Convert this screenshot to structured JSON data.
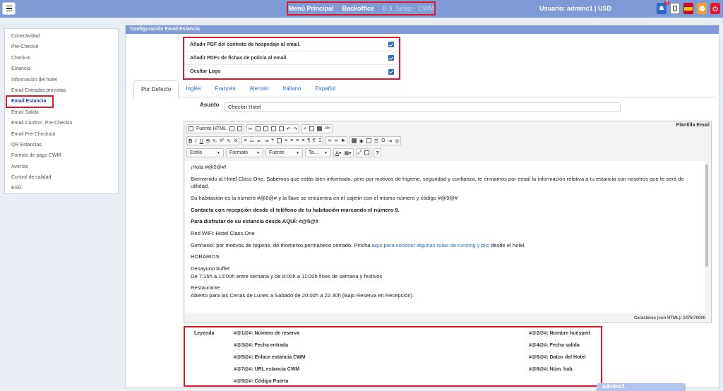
{
  "topbar": {
    "nav": [
      "Menú Principal",
      "Backoffice",
      "B.9. Setup - CWM"
    ],
    "user": "Usuario: adminc1 | USD",
    "badge_count": "8"
  },
  "sidebar": {
    "items": [
      {
        "label": "Conectividad"
      },
      {
        "label": "Pre-Checkin"
      },
      {
        "label": "Check-in"
      },
      {
        "label": "Estancia"
      },
      {
        "label": "Información del hotel"
      },
      {
        "label": "Email Entradas previstas"
      },
      {
        "label": "Email Estancia"
      },
      {
        "label": "Email Salida"
      },
      {
        "label": "Email Confirm. Pre-Checkin"
      },
      {
        "label": "Email Pre-Checkout"
      },
      {
        "label": "QR Estancias"
      },
      {
        "label": "Formas de pago CWM"
      },
      {
        "label": "Averías"
      },
      {
        "label": "Control de calidad"
      },
      {
        "label": "ESG"
      }
    ]
  },
  "panel": {
    "title": "Configuración Email Estancia",
    "checks": [
      {
        "label": "Añadir PDF del contrato de hospedaje al email.",
        "checked": true
      },
      {
        "label": "Añadir PDFs de fichas de policía al email.",
        "checked": true
      },
      {
        "label": "Ocultar Logo",
        "checked": true
      }
    ],
    "tabs": [
      "Por Defecto",
      "Inglés",
      "Francés",
      "Alemán",
      "Italiano",
      "Español"
    ],
    "subject_label": "Asunto",
    "subject_value": "Checkin Hotel"
  },
  "editor": {
    "template_label": "Plantilla Email",
    "source_label": "Fuente HTML",
    "combos": [
      "Estilo",
      "Formato",
      "Fuente",
      "Ta..."
    ],
    "counter": "Carácteres (con HTML): 1475/70000",
    "p1": "¡Hola #@2@#!",
    "p2": "Bienvenido al Hotel Class One. Sabemos que estás bien informado, pero por motivos de higiene, seguridad y confianza, te enviamos por email la información relativa a tu estancia con nosotros que te será de utilidad.",
    "p3": "Su habitación es la número #@8@# y la llave se encuentra en el cajetín con el mismo número y código #@9@#",
    "p4": "Contacta con recepción desde el teléfono de tu habitación marcando el número 9.",
    "p5": "Para disfrutar de su estancia desde AQUÍ: #@5@#",
    "p6": "Red WiFi: Hotel Class One",
    "p7_pre": "Gimnasio: por motivos de higiene, de momento permanece cerrado. Pincha ",
    "p7_link": "aquí para conocer algunas rutas de running y bici",
    "p7_post": " desde el hotel.",
    "p8": "HORARIOS",
    "p9a": "Desayuno buffet",
    "p9b": "De 7:15h a 10:00h entre semana y de 8:00h a 11:00h fines de semana y festivos",
    "p10a": "Restaurante",
    "p10b": "Abierto para las Cenas de Lunes a Sabado de 20:00h a 22.30h (Bajo Reserva en Recepción)."
  },
  "legend": {
    "title": "Leyenda",
    "v1": "#@1@#: Número de reserva",
    "v2": "#@2@#: Nombre huésped",
    "v3": "#@3@#: Fecha entrada",
    "v4": "#@4@#: Fecha salida",
    "v5": "#@5@#: Enlace estancia CWM",
    "v6": "#@6@#: Datos del Hotel",
    "v7": "#@7@#: URL estancia CWM",
    "v8": "#@8@#: Núm. hab.",
    "v9": "#@9@#: Código Puerta"
  },
  "footer_user": "adminc1"
}
